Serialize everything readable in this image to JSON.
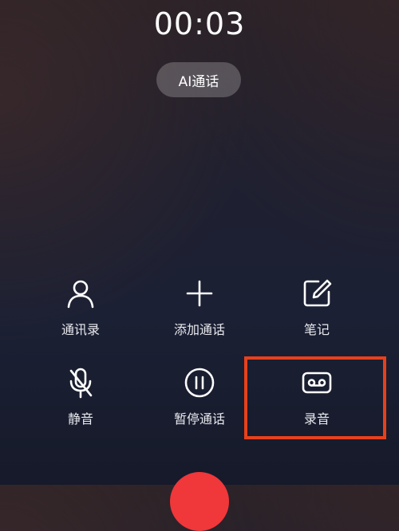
{
  "call": {
    "timer": "00:03",
    "ai_button_label": "AI通话"
  },
  "controls": [
    {
      "label": "通讯录",
      "icon": "person-icon"
    },
    {
      "label": "添加通话",
      "icon": "plus-icon"
    },
    {
      "label": "笔记",
      "icon": "note-edit-icon"
    },
    {
      "label": "静音",
      "icon": "mic-off-icon"
    },
    {
      "label": "暂停通话",
      "icon": "pause-circle-icon"
    },
    {
      "label": "录音",
      "icon": "record-tape-icon"
    }
  ],
  "colors": {
    "highlight_border": "#e8401c",
    "end_call": "#f0373a"
  }
}
